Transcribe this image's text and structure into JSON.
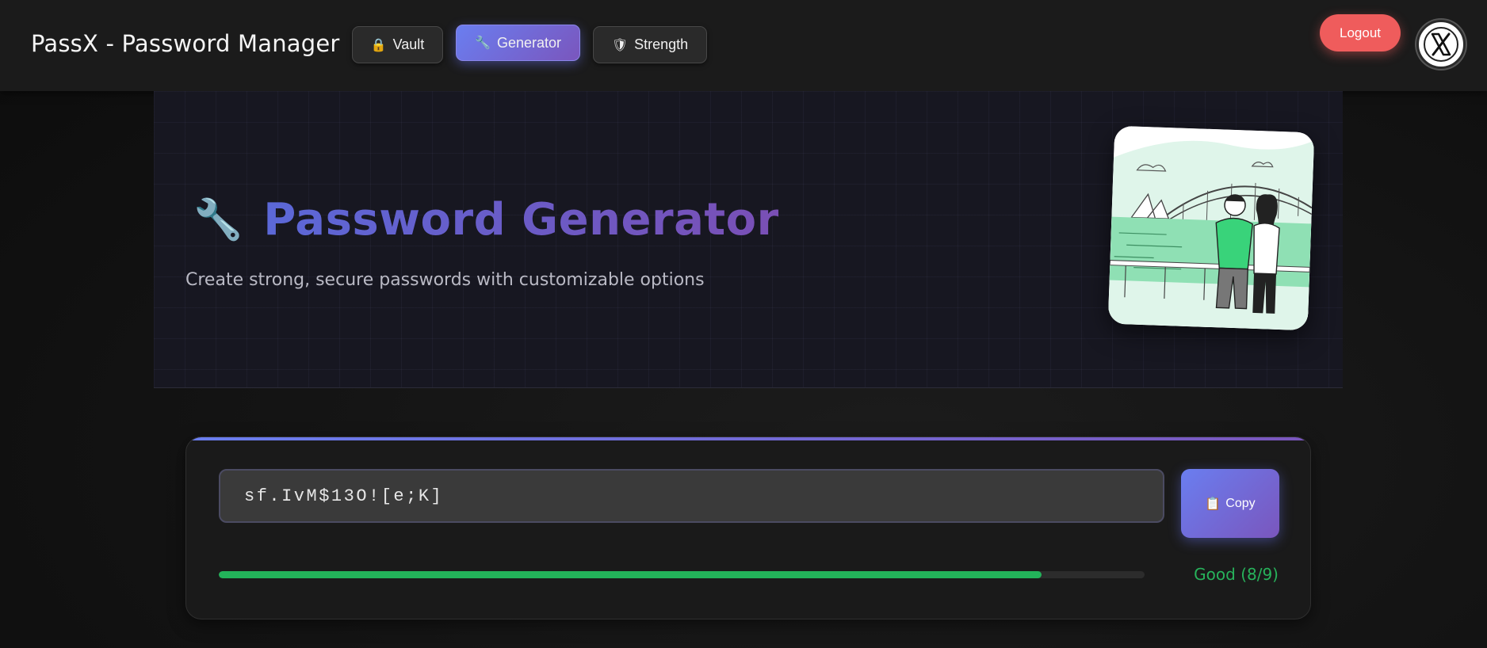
{
  "app": {
    "title": "PassX - Password Manager"
  },
  "nav": [
    {
      "label": "Vault",
      "icon": "lock-icon",
      "active": false
    },
    {
      "label": "Generator",
      "icon": "wrench-icon",
      "active": true
    },
    {
      "label": "Strength",
      "icon": "shield-icon",
      "active": false
    }
  ],
  "header": {
    "logout_label": "Logout",
    "avatar_icon": "x-logo-icon"
  },
  "hero": {
    "icon": "wrench-icon",
    "title": "Password Generator",
    "subtitle": "Create strong, secure passwords with customizable options"
  },
  "generator": {
    "password": "sf.IvM$13O![e;K]",
    "copy_label": "Copy",
    "copy_icon": "clipboard-icon",
    "strength": {
      "label": "Good (8/9)",
      "score": 8,
      "max": 9,
      "color": "#23b35a"
    }
  },
  "colors": {
    "accent_start": "#6a7ef0",
    "accent_end": "#7a56bd",
    "logout": "#ef5c5c",
    "strength_good": "#23b35a"
  }
}
